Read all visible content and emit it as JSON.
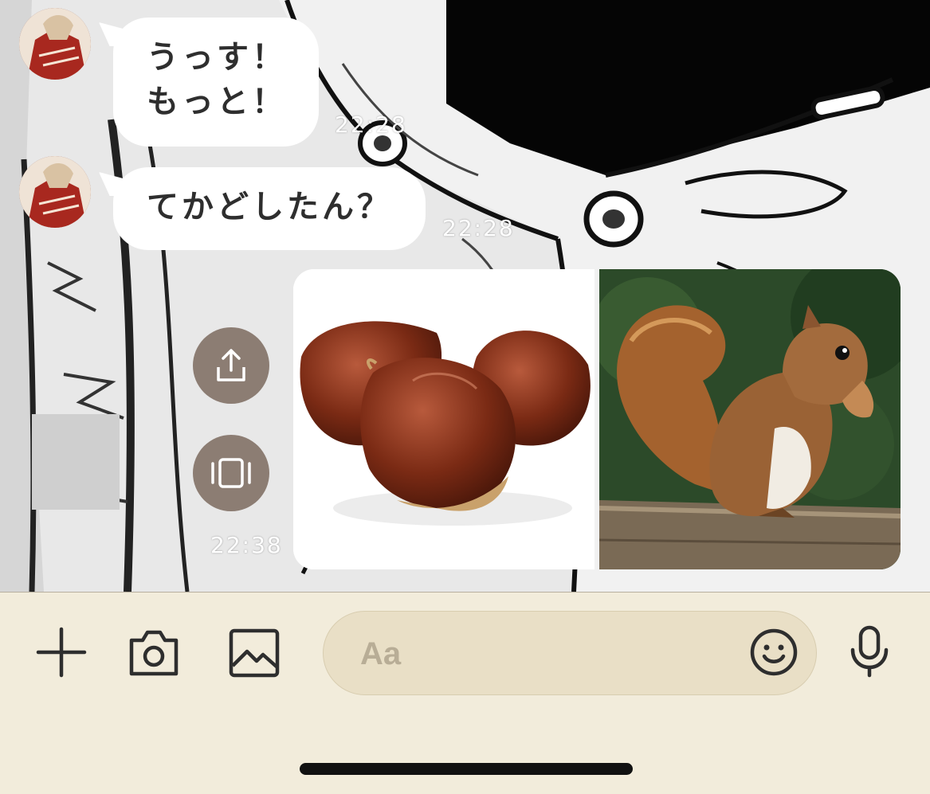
{
  "messages": [
    {
      "lines": [
        "うっす！",
        "もっと！"
      ],
      "time": "22:28"
    },
    {
      "lines": [
        "てかどしたん？"
      ],
      "time": "22:28"
    }
  ],
  "outgoing": {
    "time": "22:38"
  },
  "input": {
    "placeholder": "Aa"
  },
  "icons": {
    "plus": "plus-icon",
    "camera": "camera-icon",
    "gallery": "image-icon",
    "emoji": "smiley-icon",
    "mic": "microphone-icon",
    "share": "share-icon",
    "carousel": "carousel-icon"
  },
  "colors": {
    "bubble": "#ffffff",
    "input_bar": "#f2ecdb",
    "text_field": "#e9dfc6",
    "action_button": "#8c7d73"
  }
}
